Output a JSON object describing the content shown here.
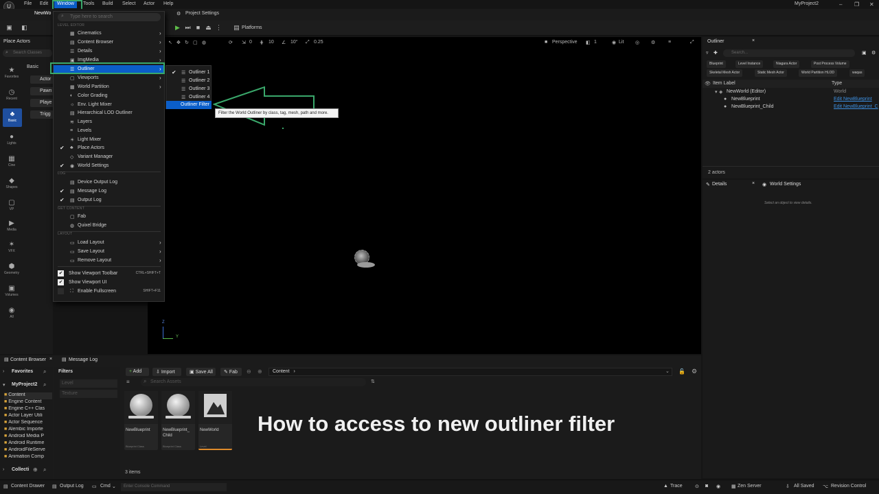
{
  "app": {
    "project_name": "MyProject2"
  },
  "menubar": {
    "items": [
      "File",
      "Edit",
      "Window",
      "Tools",
      "Build",
      "Select",
      "Actor",
      "Help"
    ]
  },
  "tabs": {
    "level_tab": "NewWo",
    "project_settings": "Project Settings"
  },
  "toolbar": {
    "platforms": "Platforms"
  },
  "viewport": {
    "perspective": "Perspective",
    "lit": "Lit",
    "grid_value": "10",
    "angle_value": "10°",
    "scale_value": "0.25",
    "fov_value": "1",
    "angle_zero": "0",
    "axis_z": "Z",
    "axis_y": "Y"
  },
  "place_actors": {
    "title": "Place Actors",
    "search_placeholder": "Search Classes",
    "tab_basic": "Basic",
    "categories": [
      "Favorites",
      "Recent",
      "Basic",
      "Lights",
      "Cine",
      "Shapes",
      "VP",
      "Media",
      "VFX",
      "Geometry",
      "Volumes",
      "All"
    ],
    "entries": [
      "Actor",
      "Pawn",
      "Playe",
      "Trigg"
    ]
  },
  "window_menu": {
    "search_placeholder": "Type here to search",
    "sections": {
      "level_editor": "LEVEL EDITOR",
      "log": "LOG",
      "get_content": "GET CONTENT",
      "layout": "LAYOUT"
    },
    "level_editor_items": [
      "Cinematics",
      "Content Browser",
      "Details",
      "ImgMedia",
      "Outliner",
      "Viewports",
      "World Partition",
      "Color Grading",
      "Env. Light Mixer",
      "Hierarchical LOD Outliner",
      "Layers",
      "Levels",
      "Light Mixer",
      "Place Actors",
      "Variant Manager",
      "World Settings"
    ],
    "log_items": [
      "Device Output Log",
      "Message Log",
      "Output Log"
    ],
    "content_items": [
      "Fab",
      "Quixel Bridge"
    ],
    "layout_items": [
      "Load Layout",
      "Save Layout",
      "Remove Layout"
    ],
    "view_items": [
      "Show Viewport Toolbar",
      "Show Viewport UI",
      "Enable Fullscreen"
    ],
    "shortcuts": {
      "toolbar": "CTRL+SHIFT+T",
      "fullscreen": "SHIFT+F11"
    }
  },
  "outliner_submenu": {
    "items": [
      "Outliner 1",
      "Outliner 2",
      "Outliner 3",
      "Outliner 4",
      "Outliner Filter"
    ]
  },
  "tooltip": {
    "text": "Filter the World Outliner by class, tag, mesh, path and more."
  },
  "outliner_panel": {
    "title": "Outliner",
    "search_placeholder": "Search...",
    "filter_chips": [
      "Blueprint",
      "Level Instance",
      "Niagara Actor",
      "Post Process Volume",
      "Skeletal Mesh Actor",
      "Static Mesh Actor",
      "World Partition HLOD",
      "waqas"
    ],
    "col_label": "Item Label",
    "col_type": "Type",
    "rows": [
      {
        "label": "NewWorld (Editor)",
        "type": "World"
      },
      {
        "label": "NewBlueprint",
        "type": "Edit NewBlueprint"
      },
      {
        "label": "NewBlueprint_Child",
        "type": "Edit NewBlueprint_C"
      }
    ],
    "count": "2 actors"
  },
  "details_panel": {
    "tab_details": "Details",
    "tab_world_settings": "World Settings",
    "empty_msg": "Select an object to view details."
  },
  "content_browser": {
    "tab": "Content Browser",
    "tab_message_log": "Message Log",
    "favorites": "Favorites",
    "project": "MyProject2",
    "collections": "Collecti",
    "filters_title": "Filters",
    "filter_items": [
      "Level",
      "Texture"
    ],
    "add": "Add",
    "import": "Import",
    "save_all": "Save All",
    "fab": "Fab",
    "path": "Content",
    "search_placeholder": "Search Assets",
    "folders": [
      "Content",
      "Engine Content",
      "Engine C++ Clas",
      "Actor Layer Utili",
      "Actor Sequence",
      "Alembic Importe",
      "Android Media P",
      "Android Runtime",
      "AndroidFileServe",
      "Animation Comp"
    ],
    "assets": [
      {
        "name": "NewBlueprint",
        "class": "Blueprint Class"
      },
      {
        "name": "NewBlueprint_ Child",
        "class": "Blueprint Class"
      },
      {
        "name": "NewWorld",
        "class": "Level"
      }
    ],
    "item_count": "3 items"
  },
  "caption": "How to access to new outliner filter",
  "statusbar": {
    "content_drawer": "Content Drawer",
    "output_log": "Output Log",
    "cmd": "Cmd",
    "console_placeholder": "Enter Console Command",
    "trace": "Trace",
    "zen_server": "Zen Server",
    "all_saved": "All Saved",
    "revision_control": "Revision Control"
  },
  "colors": {
    "accent": "#0b5ec9",
    "annotation_green": "#3aa86b",
    "link": "#3c8fe0"
  }
}
